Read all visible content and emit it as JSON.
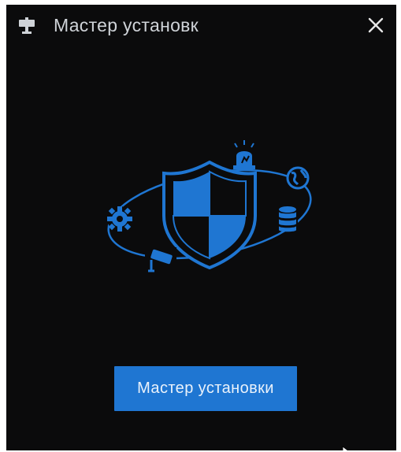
{
  "dialog": {
    "title": "Мастер установк",
    "title_icon": "signpost-icon",
    "close_icon": "close-icon"
  },
  "illustration": {
    "icons": [
      "shield-icon",
      "alarm-light-icon",
      "globe-icon",
      "database-icon",
      "gear-icon",
      "camera-icon"
    ],
    "accent_color": "#1f76d2"
  },
  "actions": {
    "wizard_button_label": "Мастер установки"
  },
  "colors": {
    "background": "#0b0b0c",
    "accent": "#1f76d2",
    "title_text": "#cfd3d8"
  }
}
